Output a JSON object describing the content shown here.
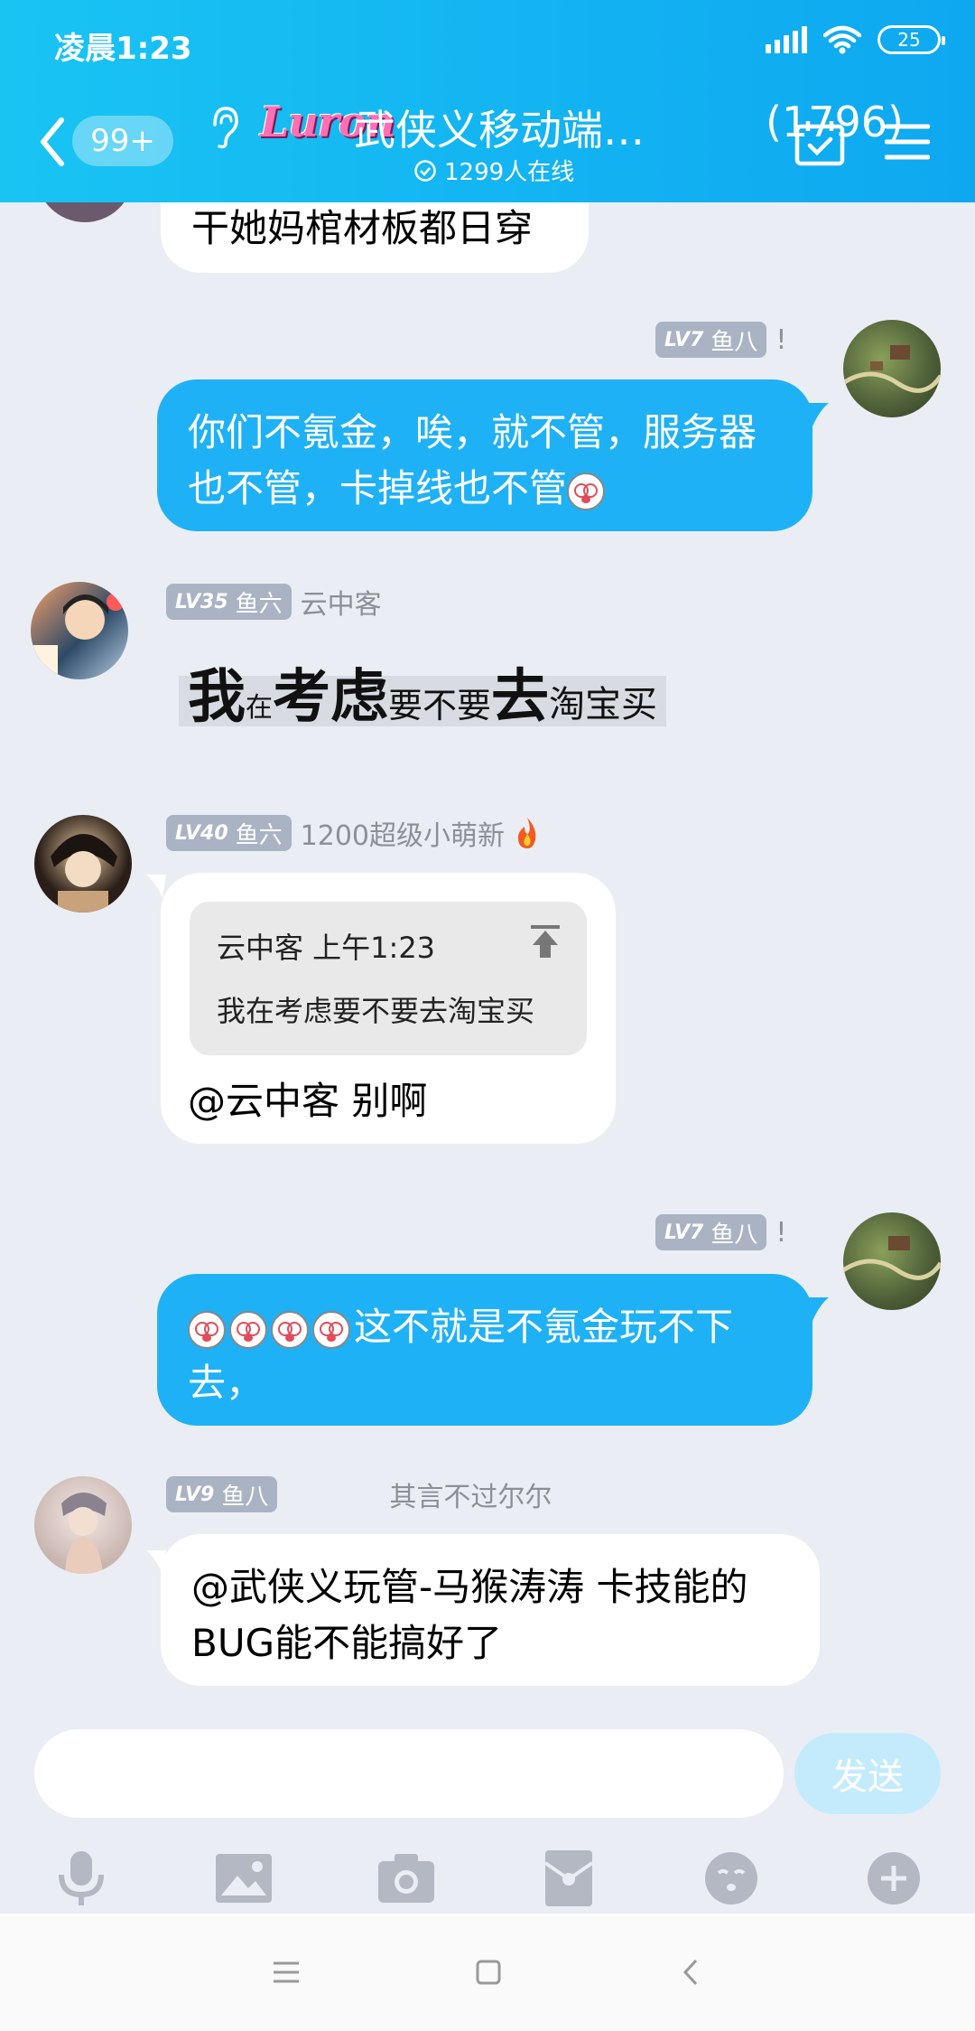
{
  "status_bar": {
    "time": "凌晨1:23",
    "battery": "25"
  },
  "header": {
    "back_badge": "99+",
    "group_logo": "Luron",
    "group_name": "武侠义移动端…",
    "member_count": "(1796)",
    "online": "1299人在线"
  },
  "messages": [
    {
      "text": "干她妈棺材板都日穿"
    },
    {
      "level": "LV7",
      "rank": "鱼八",
      "sender": "!",
      "text": "你们不氪金，唉，就不管，服务器也不管，卡掉线也不管"
    },
    {
      "level": "LV35",
      "rank": "鱼六",
      "sender": "云中客",
      "fancy_parts": [
        "我",
        "在",
        "考虑",
        "要不要",
        "去",
        "淘宝买"
      ]
    },
    {
      "level": "LV40",
      "rank": "鱼六",
      "sender": "1200超级小萌新",
      "quote_header": "云中客 上午1:23",
      "quote_text": "我在考虑要不要去淘宝买",
      "text": "@云中客 别啊"
    },
    {
      "level": "LV7",
      "rank": "鱼八",
      "sender": "!",
      "text": "这不就是不氪金玩不下去，"
    },
    {
      "level": "LV9",
      "rank": "鱼八",
      "sender": "其言不过尔尔",
      "text": "@武侠义玩管-马猴涛涛 卡技能的BUG能不能搞好了"
    }
  ],
  "input": {
    "placeholder": "",
    "send_label": "发送"
  },
  "toolbar_icons": [
    "microphone-icon",
    "image-icon",
    "camera-icon",
    "red-packet-icon",
    "emoji-icon",
    "plus-icon"
  ],
  "colors": {
    "header": "#13b4f2",
    "bubble_self": "#1fb1f5",
    "background": "#eaedf4",
    "level_badge": "#aab3c4"
  }
}
